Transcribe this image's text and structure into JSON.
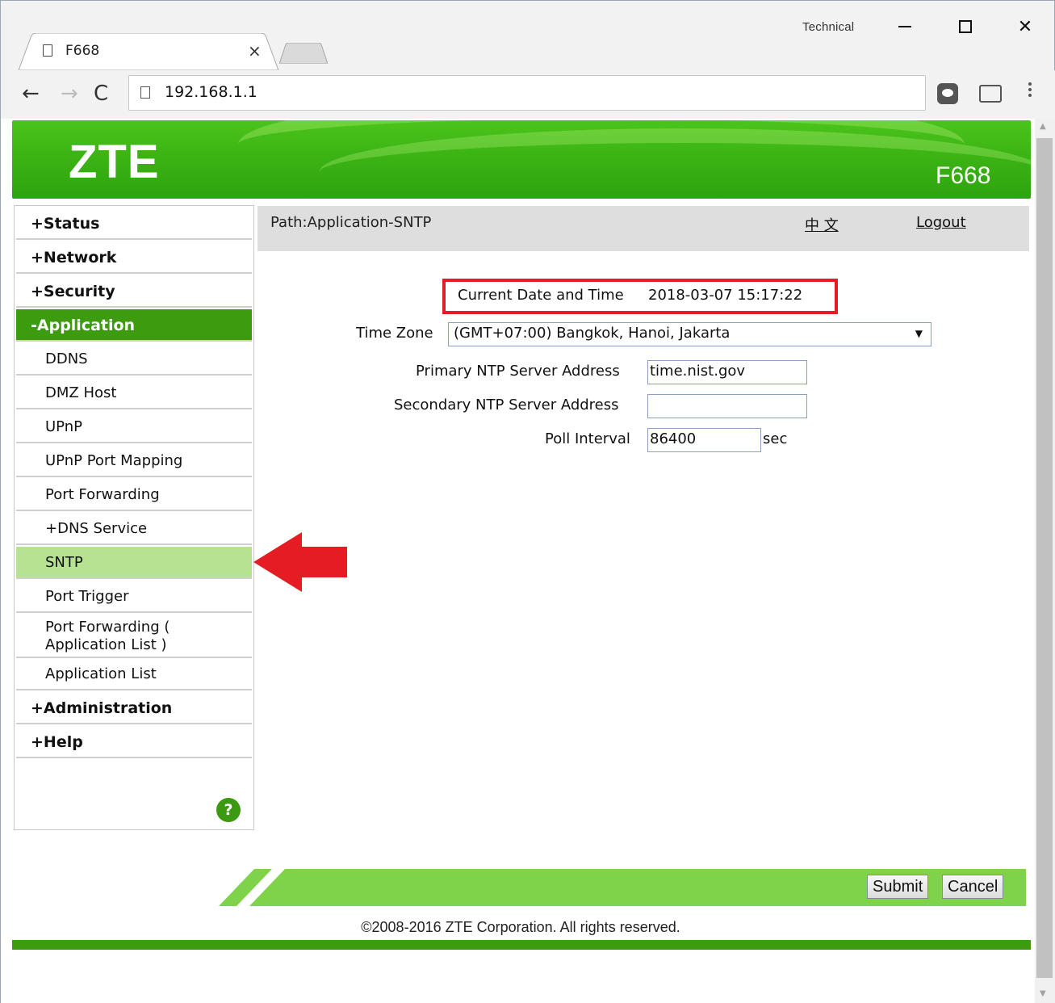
{
  "window": {
    "profile_label": "Technical",
    "controls": {
      "minimize": "minimize-icon",
      "maximize": "maximize-icon",
      "close": "close-icon"
    }
  },
  "tab": {
    "title": "F668",
    "close_glyph": "×"
  },
  "toolbar": {
    "url": "192.168.1.1"
  },
  "banner": {
    "logo": "ZTE",
    "model": "F668"
  },
  "sidebar": {
    "items": [
      {
        "label": "+Status",
        "level": 1
      },
      {
        "label": "+Network",
        "level": 1
      },
      {
        "label": "+Security",
        "level": 1
      },
      {
        "label": "-Application",
        "level": 1,
        "active": true
      },
      {
        "label": "DDNS",
        "level": 2
      },
      {
        "label": "DMZ Host",
        "level": 2
      },
      {
        "label": "UPnP",
        "level": 2
      },
      {
        "label": "UPnP Port Mapping",
        "level": 2
      },
      {
        "label": "Port Forwarding",
        "level": 2
      },
      {
        "label": "+DNS Service",
        "level": 2
      },
      {
        "label": "SNTP",
        "level": 2,
        "selected": true
      },
      {
        "label": "Port Trigger",
        "level": 2
      },
      {
        "label": "Port Forwarding (\nApplication List )",
        "level": 2
      },
      {
        "label": "Application List",
        "level": 2
      },
      {
        "label": "+Administration",
        "level": 1
      },
      {
        "label": "+Help",
        "level": 1
      }
    ],
    "help_glyph": "?"
  },
  "header": {
    "path": "Path:Application-SNTP",
    "language_link": "中 文",
    "logout": "Logout"
  },
  "form": {
    "current_time_label": "Current Date and Time",
    "current_time_value": "2018-03-07 15:17:22",
    "timezone_label": "Time Zone",
    "timezone_value": "(GMT+07:00) Bangkok, Hanoi, Jakarta",
    "primary_label": "Primary NTP Server Address",
    "primary_value": "time.nist.gov",
    "secondary_label": "Secondary NTP Server Address",
    "secondary_value": "",
    "poll_label": "Poll Interval",
    "poll_value": "86400",
    "poll_unit": "sec"
  },
  "buttons": {
    "submit": "Submit",
    "cancel": "Cancel"
  },
  "footer": {
    "copyright": "©2008-2016 ZTE Corporation. All rights reserved."
  },
  "colors": {
    "brand_green": "#3d9b10",
    "selected_green": "#b7e291",
    "highlight_red": "#e51c23"
  }
}
